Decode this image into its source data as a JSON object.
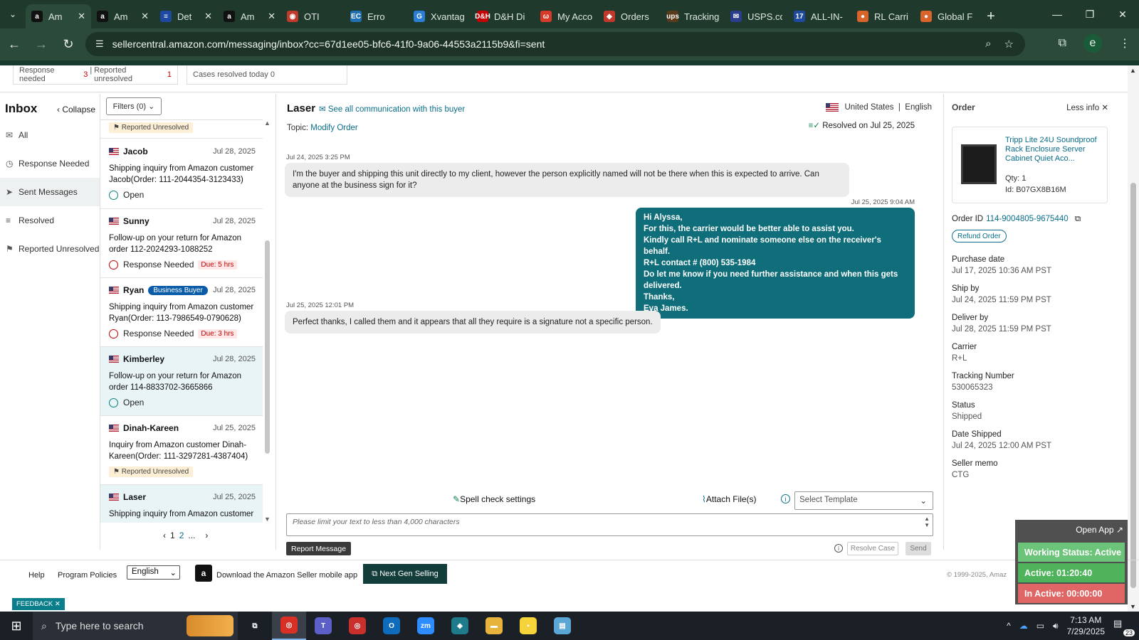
{
  "browser": {
    "tabs": [
      {
        "label": "Am",
        "icon": "amazon-icon",
        "color": "#111111",
        "glyph": "a",
        "active": true
      },
      {
        "label": "Am",
        "icon": "amazon-icon",
        "color": "#111111",
        "glyph": "a"
      },
      {
        "label": "Det",
        "icon": "flag-icon",
        "color": "#1d4aa0",
        "glyph": "≡"
      },
      {
        "label": "Am",
        "icon": "amazon-icon",
        "color": "#111111",
        "glyph": "a"
      },
      {
        "label": "OTI",
        "icon": "truck-icon",
        "color": "#c0392b",
        "glyph": "◉"
      },
      {
        "label": "Erro",
        "icon": "ec-icon",
        "color": "#1f6fb2",
        "glyph": "EC"
      },
      {
        "label": "Xvantag",
        "icon": "xvantage-icon",
        "color": "#2a7fd4",
        "glyph": "G"
      },
      {
        "label": "D&H Di",
        "icon": "dh-icon",
        "color": "#c40000",
        "glyph": "D&H"
      },
      {
        "label": "My Acco",
        "icon": "account-icon",
        "color": "#d83a2a",
        "glyph": "ω"
      },
      {
        "label": "Orders",
        "icon": "orders-icon",
        "color": "#c0392b",
        "glyph": "◆"
      },
      {
        "label": "Tracking",
        "icon": "ups-icon",
        "color": "#5b3a1a",
        "glyph": "ups"
      },
      {
        "label": "USPS.co",
        "icon": "usps-icon",
        "color": "#2a3e8c",
        "glyph": "✉"
      },
      {
        "label": "ALL-IN-",
        "icon": "allin-icon",
        "color": "#1d4aa0",
        "glyph": "17"
      },
      {
        "label": "RL Carri",
        "icon": "rl-icon",
        "color": "#d9642b",
        "glyph": "●"
      },
      {
        "label": "Global F",
        "icon": "global-icon",
        "color": "#d9642b",
        "glyph": "●"
      }
    ],
    "url": "sellercentral.amazon.com/messaging/inbox?cc=67d1ee05-bfc6-41f0-9a06-44553a2115b9&fi=sent",
    "profile_initial": "e"
  },
  "stats": {
    "response_needed_label": "Response needed",
    "response_needed_count": "3",
    "reported_unresolved_label": "Reported unresolved",
    "reported_unresolved_count": "1",
    "cases_resolved_label": "Cases resolved today",
    "cases_resolved_count": "0"
  },
  "nav": {
    "title": "Inbox",
    "collapse": "Collapse",
    "items": [
      "All",
      "Response Needed",
      "Sent Messages",
      "Resolved",
      "Reported Unresolved"
    ],
    "active_index": 2
  },
  "list": {
    "filters_label": "Filters (0)",
    "top_badge": "Reported Unresolved",
    "conversations": [
      {
        "name": "Jacob",
        "date": "Jul 28, 2025",
        "subject": "Shipping inquiry from Amazon customer Jacob(Order: 111-2044354-3123433)",
        "status": "Open",
        "due": ""
      },
      {
        "name": "Sunny",
        "date": "Jul 28, 2025",
        "subject": "Follow-up on your return for Amazon order 112-2024293-1088252",
        "status": "Response Needed",
        "due": "Due: 5 hrs"
      },
      {
        "name": "Ryan",
        "badge": "Business Buyer",
        "date": "Jul 28, 2025",
        "subject": "Shipping inquiry from Amazon customer Ryan(Order: 113-7986549-0790628)",
        "status": "Response Needed",
        "due": "Due: 3 hrs"
      },
      {
        "name": "Kimberley",
        "date": "Jul 28, 2025",
        "subject": "Follow-up on your return for Amazon order 114-8833702-3665866",
        "status": "Open",
        "due": ""
      },
      {
        "name": "Dinah-Kareen",
        "date": "Jul 25, 2025",
        "subject": "Inquiry from Amazon customer Dinah-Kareen(Order: 111-3297281-4387404)",
        "status": "Reported Unresolved",
        "due": ""
      },
      {
        "name": "Laser",
        "date": "Jul 25, 2025",
        "subject": "Shipping inquiry from Amazon customer",
        "status": "",
        "due": ""
      }
    ],
    "pager": {
      "current": "1",
      "next": "2",
      "more": "..."
    }
  },
  "thread": {
    "buyer": "Laser",
    "see_all": "See all communication with this buyer",
    "topic_label": "Topic:",
    "topic_value": "Modify Order",
    "country": "United States",
    "language": "English",
    "resolved": "Resolved on Jul 25, 2025",
    "messages": [
      {
        "dir": "in",
        "time": "Jul 24, 2025 3:25 PM",
        "text": "I'm the buyer and shipping this unit directly to my client, however the person explicitly named will not be there when this is expected to arrive. Can anyone at the business sign for it?"
      },
      {
        "dir": "out",
        "time": "Jul 25, 2025 9:04 AM",
        "lines": [
          "Hi Alyssa,",
          "For this, the carrier would be better able to assist you.",
          "Kindly call R+L and nominate someone else on the receiver's behalf.",
          "R+L contact # (800) 535-1984",
          "Do let me know if you need further assistance and when this gets delivered.",
          "Thanks,",
          "Eva James."
        ]
      },
      {
        "dir": "in",
        "time": "Jul 25, 2025 12:01 PM",
        "text": "Perfect thanks, I called them and it appears that all they require is a signature not a specific person."
      }
    ],
    "spell_check": "Spell check settings",
    "attach": "Attach File(s)",
    "template_placeholder": "Select Template",
    "input_placeholder": "Please limit your text to less than 4,000 characters",
    "report_btn": "Report Message",
    "resolve_btn": "Resolve Case",
    "send_btn": "Send"
  },
  "order": {
    "title": "Order",
    "less_info": "Less info",
    "product_title": "Tripp Lite 24U Soundproof Rack Enclosure Server Cabinet Quiet Aco...",
    "qty": "Qty: 1",
    "id": "Id: B07GX8B16M",
    "order_id_label": "Order ID",
    "order_id": "114-9004805-9675440",
    "refund_btn": "Refund Order",
    "fields": [
      {
        "label": "Purchase date",
        "value": "Jul 17, 2025 10:36 AM PST"
      },
      {
        "label": "Ship by",
        "value": "Jul 24, 2025 11:59 PM PST"
      },
      {
        "label": "Deliver by",
        "value": "Jul 28, 2025 11:59 PM PST"
      },
      {
        "label": "Carrier",
        "value": "R+L"
      },
      {
        "label": "Tracking Number",
        "value": "530065323"
      },
      {
        "label": "Status",
        "value": "Shipped"
      },
      {
        "label": "Date Shipped",
        "value": "Jul 24, 2025 12:00 AM PST"
      },
      {
        "label": "Seller memo",
        "value": "CTG"
      }
    ]
  },
  "footer": {
    "help": "Help",
    "policies": "Program Policies",
    "language": "English",
    "mobile": "Download the Amazon Seller mobile app",
    "next_gen": "Next Gen Selling",
    "copyright": "© 1999-2025, Amaz",
    "feedback": "FEEDBACK"
  },
  "widget": {
    "open_app": "Open App",
    "working": "Working Status: Active",
    "active": "Active: 01:20:40",
    "inactive": "In Active: 00:00:00",
    "colors": {
      "working": "#6cc47a",
      "active": "#4eb35a",
      "inactive": "#e06565"
    }
  },
  "taskbar": {
    "search": "Type here to search",
    "time": "7:13 AM",
    "date": "7/29/2025",
    "notif_count": "23",
    "apps": [
      {
        "name": "task-view-icon",
        "color": "#1b2027",
        "glyph": "⧉"
      },
      {
        "name": "chrome-icon",
        "color": "#d93025",
        "glyph": "◎",
        "active": true
      },
      {
        "name": "teams-icon",
        "color": "#5b5fc7",
        "glyph": "T"
      },
      {
        "name": "chrome-profile-icon",
        "color": "#c9302c",
        "glyph": "◎"
      },
      {
        "name": "outlook-icon",
        "color": "#0f6cbd",
        "glyph": "O"
      },
      {
        "name": "zoom-icon",
        "color": "#2d8cff",
        "glyph": "zm"
      },
      {
        "name": "app-diamond-icon",
        "color": "#1e7b8c",
        "glyph": "◆"
      },
      {
        "name": "file-explorer-icon",
        "color": "#e8b33a",
        "glyph": "▬"
      },
      {
        "name": "sticky-notes-icon",
        "color": "#f4d33b",
        "glyph": "▪"
      },
      {
        "name": "notepad-icon",
        "color": "#5aa7d6",
        "glyph": "▤"
      }
    ]
  }
}
